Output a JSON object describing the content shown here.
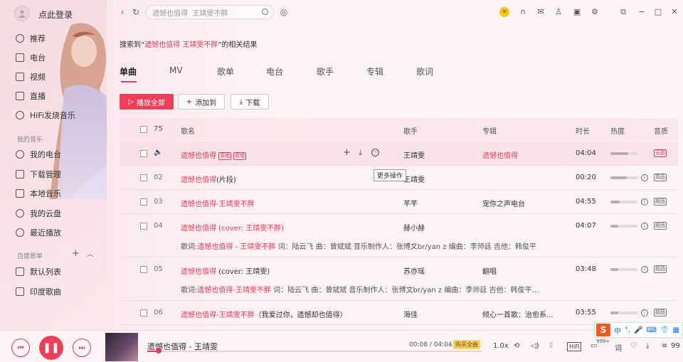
{
  "sidebar": {
    "login": "点此登录",
    "top_items": [
      {
        "label": "推荐",
        "icon": "star-icon"
      },
      {
        "label": "电台",
        "icon": "radio-icon"
      },
      {
        "label": "视频",
        "icon": "video-icon"
      },
      {
        "label": "直播",
        "icon": "live-icon"
      },
      {
        "label": "HiFi发烧音乐",
        "icon": "hifi-icon"
      }
    ],
    "my_music_title": "我的音乐",
    "my_music": [
      {
        "label": "我的电台",
        "icon": "radio-icon"
      },
      {
        "label": "下载管理",
        "icon": "download-icon"
      },
      {
        "label": "本地音乐",
        "icon": "monitor-icon"
      },
      {
        "label": "我的云盘",
        "icon": "cloud-icon"
      },
      {
        "label": "最近播放",
        "icon": "clock-icon"
      }
    ],
    "playlists_title": "自建歌单",
    "playlists": [
      {
        "label": "默认列表",
        "icon": "list-icon"
      },
      {
        "label": "印度歌曲",
        "icon": "list-icon"
      }
    ]
  },
  "topbar": {
    "search_value": "遗憾也值得  王靖雯不胖"
  },
  "search_result": {
    "prefix": "搜索到“",
    "keyword": "遗憾也值得 王靖雯不胖",
    "suffix": "”的相关结果"
  },
  "tabs": [
    "单曲",
    "MV",
    "歌单",
    "电台",
    "歌手",
    "专辑",
    "歌词"
  ],
  "actions": {
    "play_all": "播放全部",
    "add_to": "添加到",
    "download": "下载"
  },
  "table": {
    "count": "75",
    "headers": {
      "title": "歌名",
      "artist": "歌手",
      "album": "专辑",
      "duration": "时长",
      "heat": "热度",
      "quality": "音质"
    },
    "rows": [
      {
        "num": "",
        "title": "遗憾也值得",
        "title_plain": "",
        "tags": [
          "原唱",
          "原唱"
        ],
        "artist": "王靖雯",
        "album": "遗憾也值得",
        "duration": "04:04",
        "heat": 0.65,
        "quality": "无损",
        "lyric": null
      },
      {
        "num": "02",
        "title": "遗憾也值得",
        "title_plain": "(片段)",
        "tags": [],
        "artist": "王靖雯",
        "album": "",
        "duration": "00:20",
        "heat": 0.6,
        "quality": "高品",
        "lyric": null
      },
      {
        "num": "03",
        "title": "遗憾也值得-王靖雯不胖",
        "title_plain": "",
        "tags": [],
        "artist": "芊芊",
        "album": "宠你之声电台",
        "duration": "04:55",
        "heat": 0.35,
        "quality": "超品",
        "lyric": null
      },
      {
        "num": "04",
        "title": "遗憾也值得 (cover: 王靖雯不胖)",
        "title_plain": "",
        "tags": [],
        "artist": "赫小赫",
        "album": "",
        "duration": "04:07",
        "heat": 0.3,
        "quality": "超品",
        "lyric": {
          "prefix": "歌词:",
          "hl": "遗憾也值得 - 王靖雯不胖",
          "rest": " 词：陆云飞 曲：曾斌斌 音乐制作人：张博文br/yan z 编曲：李师廷 吉他：韩俊平"
        }
      },
      {
        "num": "05",
        "title": "遗憾也值得",
        "title_plain": " (cover: 王靖雯)",
        "tags": [],
        "artist": "苏亦瑶",
        "album": "翻唱",
        "duration": "03:48",
        "heat": 0.3,
        "quality": "超品",
        "lyric": {
          "prefix": "歌词:",
          "hl": "遗憾也值得-王靖雯不胖",
          "rest": " 词：陆云飞 曲：曾斌斌 音乐制作人：张博文br/yan z 编曲：李师廷 吉他：韩俊平..."
        }
      },
      {
        "num": "06",
        "title": "遗憾也值得-王靖雯不胖",
        "title_plain": "（我爱过你，遗憾却也值得）",
        "tags": [],
        "artist": "海佳",
        "album": "倾心一首歌：治愈系...",
        "duration": "03:55",
        "heat": 0.3,
        "quality": "超品",
        "lyric": null
      }
    ]
  },
  "tooltip": "更多操作",
  "player": {
    "title": "遗憾也值得 - 王靖雯",
    "time": "00:08 / 04:04",
    "buy": "购买全曲",
    "progress": 0.033,
    "speed": "1.0x",
    "hifi": "HiFi",
    "comment_count": "999+",
    "playlist_count": "99"
  },
  "ime": {
    "label": "中"
  },
  "colors": {
    "accent": "#e43c5c",
    "play_button": "#ee3e58"
  }
}
